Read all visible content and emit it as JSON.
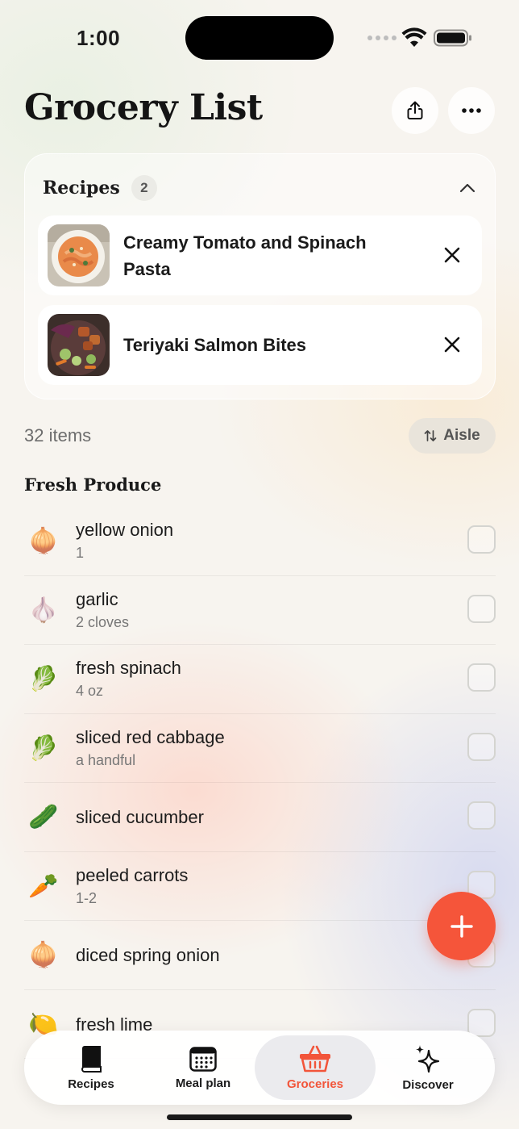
{
  "status_bar": {
    "time": "1:00"
  },
  "header": {
    "title": "Grocery List",
    "share_icon": "share-icon",
    "more_icon": "ellipsis-icon"
  },
  "recipes": {
    "title": "Recipes",
    "count": "2",
    "items": [
      {
        "name": "Creamy Tomato and Spinach Pasta",
        "image": "pasta-thumbnail"
      },
      {
        "name": "Teriyaki Salmon Bites",
        "image": "salmon-bowl-thumbnail"
      }
    ]
  },
  "list_meta": {
    "count_label": "32 items",
    "sort_label": "Aisle"
  },
  "sections": [
    {
      "title": "Fresh Produce",
      "items": [
        {
          "emoji": "🧅",
          "name": "yellow onion",
          "qty": "1"
        },
        {
          "emoji": "🧄",
          "name": "garlic",
          "qty": "2 cloves"
        },
        {
          "emoji": "🥬",
          "name": "fresh spinach",
          "qty": "4 oz"
        },
        {
          "emoji": "🥬",
          "name": "sliced red cabbage",
          "qty": "a handful"
        },
        {
          "emoji": "🥒",
          "name": "sliced cucumber",
          "qty": ""
        },
        {
          "emoji": "🥕",
          "name": "peeled carrots",
          "qty": "1-2"
        },
        {
          "emoji": "🧅",
          "name": "diced spring onion",
          "qty": ""
        },
        {
          "emoji": "🍋",
          "name": "fresh lime",
          "qty": ""
        }
      ]
    }
  ],
  "tab_bar": {
    "tabs": [
      {
        "label": "Recipes",
        "icon": "book-icon"
      },
      {
        "label": "Meal plan",
        "icon": "calendar-icon"
      },
      {
        "label": "Groceries",
        "icon": "basket-icon",
        "active": true
      },
      {
        "label": "Discover",
        "icon": "sparkles-icon"
      }
    ]
  },
  "colors": {
    "accent": "#f5553a",
    "background": "#f7f4ef"
  }
}
